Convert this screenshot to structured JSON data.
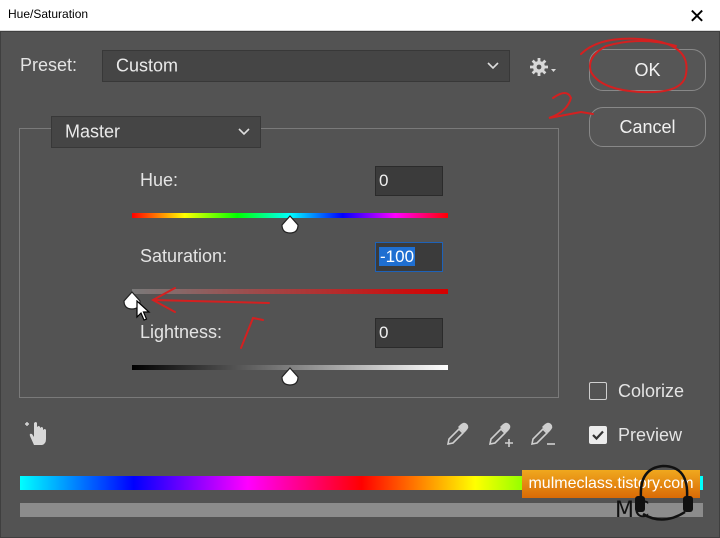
{
  "window": {
    "title": "Hue/Saturation",
    "close_glyph": "✕"
  },
  "preset": {
    "label": "Preset:",
    "value": "Custom"
  },
  "buttons": {
    "ok": "OK",
    "cancel": "Cancel"
  },
  "channel": {
    "value": "Master"
  },
  "hue": {
    "label": "Hue:",
    "value": "0",
    "slider_percent": 50
  },
  "saturation": {
    "label": "Saturation:",
    "value": "-100",
    "slider_percent": 0
  },
  "lightness": {
    "label": "Lightness:",
    "value": "0",
    "slider_percent": 50
  },
  "colorize": {
    "label": "Colorize",
    "checked": false
  },
  "preview": {
    "label": "Preview",
    "checked": true
  },
  "watermark": {
    "text": "mulmeclass.tistory.com",
    "logo_text": "MC"
  },
  "annotations": {
    "step1": "1",
    "step2": "2"
  },
  "icons": [
    "close-icon",
    "chevron-down-icon",
    "gear-icon",
    "targeted-adjustment-hand-icon",
    "eyedropper-icon",
    "eyedropper-plus-icon",
    "eyedropper-minus-icon",
    "checkmark-icon",
    "cursor-arrow-icon"
  ],
  "colors": {
    "dialog_bg": "#535353",
    "field_bg": "#3b3b3b",
    "selection": "#1f6fd1",
    "annotation": "#d42020"
  }
}
